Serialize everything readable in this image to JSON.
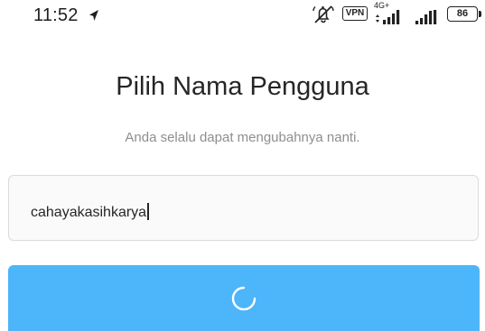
{
  "status_bar": {
    "time": "11:52",
    "vpn_label": "VPN",
    "network_type": "4G+",
    "battery_level": "86",
    "icons": [
      "navigation-arrow-icon",
      "muted-icon",
      "signal-icon",
      "signal-icon",
      "battery-icon"
    ]
  },
  "main": {
    "title": "Pilih Nama Pengguna",
    "subtitle": "Anda selalu dapat mengubahnya nanti.",
    "username_input": {
      "value": "cahayakasihkarya"
    },
    "next_button": {
      "state": "loading",
      "icon": "spinner-icon"
    }
  },
  "colors": {
    "button": "#4db5f9",
    "title_text": "#262626",
    "subtitle_text": "#8e8e8e",
    "input_border": "#dbdbdb",
    "input_background": "#fafafa"
  }
}
